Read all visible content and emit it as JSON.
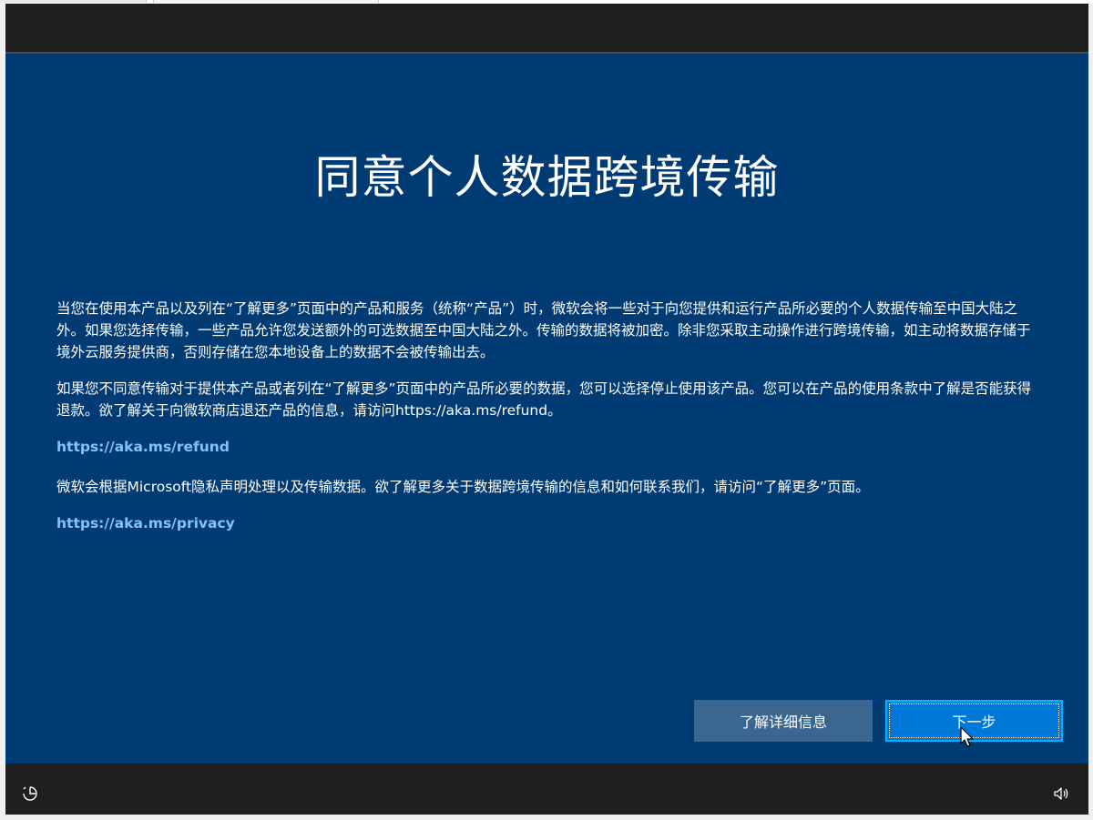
{
  "window": {
    "title": "同意个人数据跨境传输"
  },
  "body": {
    "paragraph_1": "当您在使用本产品以及列在“了解更多”页面中的产品和服务（统称“产品”）时，微软会将一些对于向您提供和运行产品所必要的个人数据传输至中国大陆之外。如果您选择传输，一些产品允许您发送额外的可选数据至中国大陆之外。传输的数据将被加密。除非您采取主动操作进行跨境传输，如主动将数据存储于境外云服务提供商，否则存储在您本地设备上的数据不会被传输出去。",
    "paragraph_2": "如果您不同意传输对于提供本产品或者列在“了解更多”页面中的产品所必要的数据，您可以选择停止使用该产品。您可以在产品的使用条款中了解是否能获得退款。欲了解关于向微软商店退还产品的信息，请访问https://aka.ms/refund。",
    "link_refund": "https://aka.ms/refund",
    "paragraph_3": "微软会根据Microsoft隐私声明处理以及传输数据。欲了解更多关于数据跨境传输的信息和如何联系我们，请访问“了解更多”页面。",
    "link_privacy": "https://aka.ms/privacy"
  },
  "buttons": {
    "learn_more": "了解详细信息",
    "next": "下一步"
  },
  "taskbar": {
    "left_icon": "ease-of-access-icon",
    "right_icon": "volume-icon"
  },
  "colors": {
    "background": "#003b73",
    "primary_button": "#0078d7",
    "secondary_button": "#3a6690",
    "link": "#82c3ff"
  }
}
